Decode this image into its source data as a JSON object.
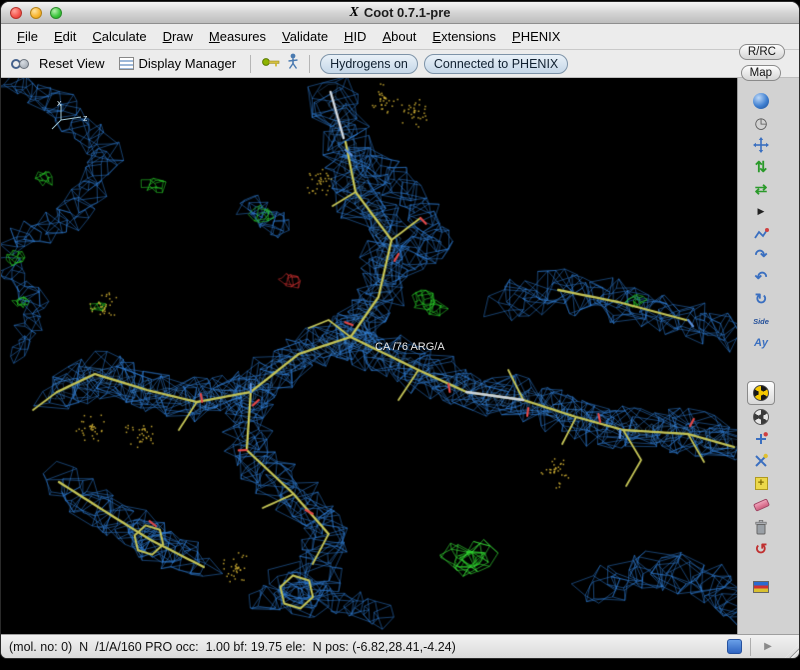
{
  "window": {
    "title": "Coot 0.7.1-pre"
  },
  "menubar": {
    "menus": [
      "File",
      "Edit",
      "Calculate",
      "Draw",
      "Measures",
      "Validate",
      "HID",
      "About",
      "Extensions",
      "PHENIX"
    ]
  },
  "toolbar": {
    "reset_view": "Reset View",
    "display_manager": "Display Manager",
    "hydrogens_toggle": "Hydrogens on",
    "phenix_status": "Connected to PHENIX"
  },
  "corner_buttons": {
    "rrc": "R/RC",
    "map": "Map"
  },
  "viewport": {
    "residue_label": "CA /76 ARG/A",
    "axis_x_label": "x",
    "axis_z_label": "z"
  },
  "right_toolbar": {
    "side_label": "Side",
    "mutate_label": "Ay"
  },
  "icon_glyphs": {
    "x11": "X",
    "timer": "◷",
    "refine": "⇅",
    "regularize": "⇄",
    "play": "▶",
    "flip_peptide": "↷",
    "sidechain_flip": "↶",
    "rotate_translate": "↻",
    "undo": "↺",
    "expander": "▶"
  },
  "statusbar": {
    "text": "(mol. no: 0)  N  /1/A/160 PRO occ:  1.00 bf: 19.75 ele:  N pos: (-6.82,28.41,-4.24)"
  },
  "colors": {
    "mesh_blue": "#2f7fd8",
    "mesh_blue_light": "#4a97e8",
    "density_green": "#28c828",
    "density_green_bright": "#3ae23a",
    "density_red": "#d23030",
    "model_yellow": "#c3c356",
    "model_light": "#ccd4dc",
    "atom_red": "#e04848",
    "atom_blue": "#5a8fd8",
    "dots_yellow": "#c8a832"
  }
}
